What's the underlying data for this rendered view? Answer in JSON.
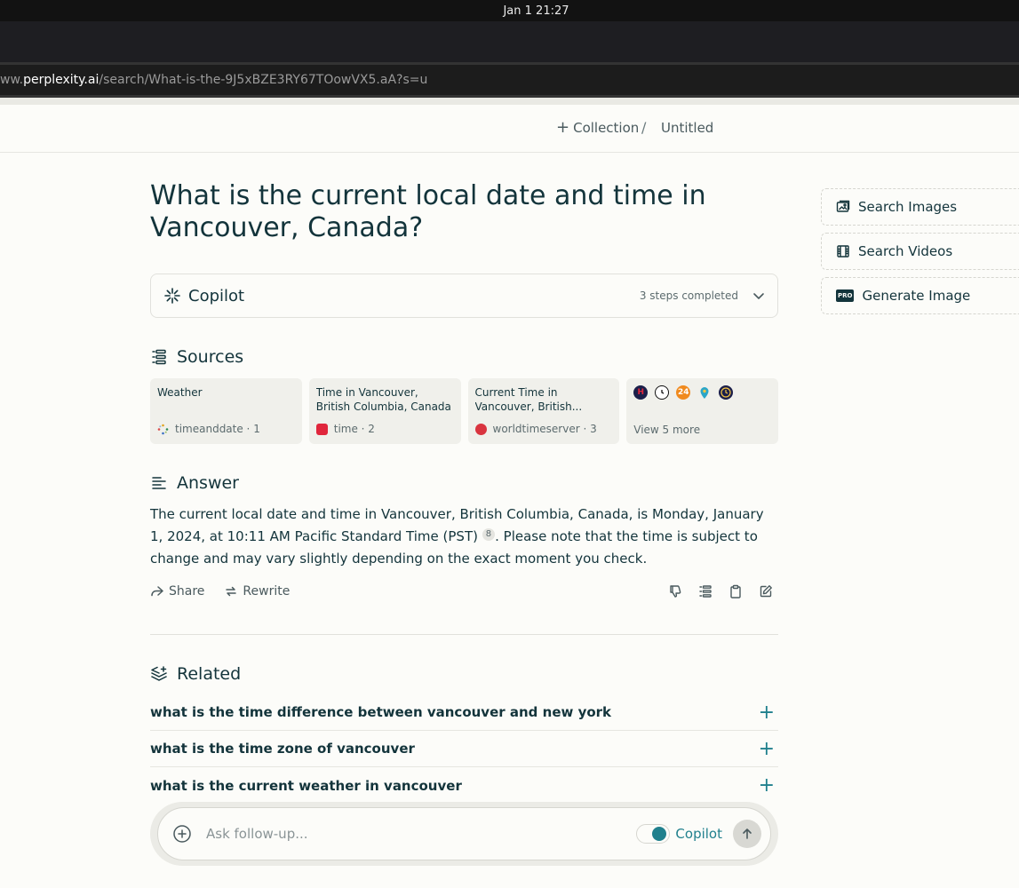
{
  "os": {
    "clock": "Jan 1  21:27"
  },
  "browser": {
    "url_prefix": "ww.",
    "url_host": "perplexity.ai",
    "url_path": "/search/What-is-the-9J5xBZE3RY67TOowVX5.aA?s=u"
  },
  "header": {
    "collection_label": "Collection",
    "separator": "/",
    "title": "Untitled"
  },
  "question": "What is the current local date and time in Vancouver, Canada?",
  "copilot": {
    "label": "Copilot",
    "steps": "3 steps completed"
  },
  "sources": {
    "title": "Sources",
    "items": [
      {
        "title": "Weather",
        "site": "timeanddate · 1"
      },
      {
        "title": "Time in Vancouver, British Columbia, Canada now",
        "site": "time · 2"
      },
      {
        "title": "Current Time in Vancouver, British...",
        "site": "worldtimeserver · 3"
      }
    ],
    "more_label": "View 5 more"
  },
  "answer": {
    "title": "Answer",
    "text_before": "The current local date and time in Vancouver, British Columbia, Canada, is Monday, January 1, 2024, at 10:11 AM Pacific Standard Time (PST) ",
    "citation": "8",
    "text_after": ". Please note that the time is subject to change and may vary slightly depending on the exact moment you check.",
    "share_label": "Share",
    "rewrite_label": "Rewrite"
  },
  "related": {
    "title": "Related",
    "items": [
      "what is the time difference between vancouver and new york",
      "what is the time zone of vancouver",
      "what is the current weather in vancouver"
    ]
  },
  "followup": {
    "placeholder": "Ask follow-up...",
    "copilot_label": "Copilot",
    "copilot_on": true
  },
  "sidebar": {
    "search_images": "Search Images",
    "search_videos": "Search Videos",
    "generate_image": "Generate Image",
    "pro_badge": "PRO"
  },
  "colors": {
    "accent": "#20808d",
    "text": "#13343b",
    "background": "#fcfcf9"
  }
}
